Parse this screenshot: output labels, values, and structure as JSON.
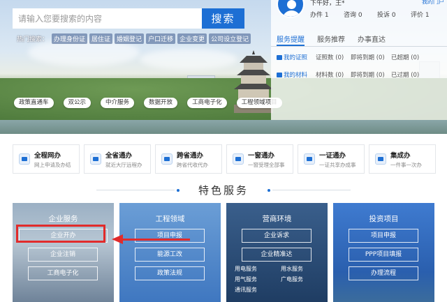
{
  "search": {
    "placeholder": "请输入您要搜索的内容",
    "button_label": "搜索"
  },
  "hot_search": {
    "label": "热门搜索：",
    "tags": [
      "办理身份证",
      "居住证",
      "婚姻登记",
      "户口迁移",
      "企业变更",
      "公司设立登记"
    ]
  },
  "quick_pills": [
    "政策直通车",
    "双公示",
    "中介服务",
    "数据开放",
    "工商电子化",
    "工程领域项目"
  ],
  "user_panel": {
    "greeting": "下午好，王*",
    "login_link": "我的门户",
    "stats": [
      {
        "label": "办件",
        "value": "1"
      },
      {
        "label": "咨询",
        "value": "0"
      },
      {
        "label": "投诉",
        "value": "0"
      },
      {
        "label": "评价",
        "value": "1"
      }
    ],
    "tabs": [
      "服务提醒",
      "服务推荐",
      "办事直达"
    ],
    "active_tab": "服务提醒",
    "rows": [
      {
        "title": "我的证照",
        "cells": [
          "证照数 (0)",
          "即将到期 (0)",
          "已超期 (0)"
        ]
      },
      {
        "title": "我的材料",
        "cells": [
          "材料数 (0)",
          "即将到期 (0)",
          "已过期 (0)"
        ]
      }
    ]
  },
  "service_cards": [
    {
      "title": "全程网办",
      "subtitle": "网上申请及办结"
    },
    {
      "title": "全省通办",
      "subtitle": "就近大厅远程办"
    },
    {
      "title": "跨省通办",
      "subtitle": "跨省代收代办"
    },
    {
      "title": "一窗通办",
      "subtitle": "一窗受理全部事"
    },
    {
      "title": "一证通办",
      "subtitle": "一证共享办成事"
    },
    {
      "title": "集成办",
      "subtitle": "一件事一次办"
    }
  ],
  "featured": {
    "title": "特色服务",
    "panes": [
      {
        "title": "企业服务",
        "buttons": [
          "企业开办",
          "企业注销",
          "工商电子化"
        ]
      },
      {
        "title": "工程领域",
        "buttons": [
          "项目申报",
          "能源工改",
          "政策法规"
        ]
      },
      {
        "title": "营商环境",
        "buttons": [
          "企业诉求",
          "企业精准达"
        ],
        "small_buttons": [
          "用电服务",
          "用水服务",
          "用气服务",
          "广电服务",
          "通讯服务"
        ]
      },
      {
        "title": "投资项目",
        "buttons": [
          "项目申报",
          "PPP项目填报",
          "办理流程"
        ]
      }
    ]
  },
  "colors": {
    "accent": "#1d6fd4",
    "annotation_red": "#e12b2b"
  }
}
